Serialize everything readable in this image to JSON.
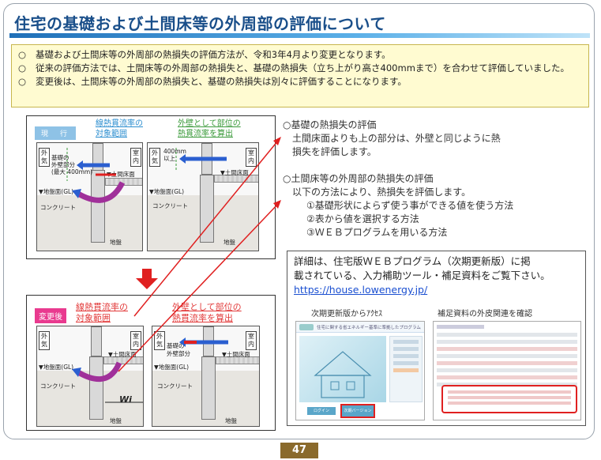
{
  "title": "住宅の基礎および土間床等の外周部の評価について",
  "notice": [
    {
      "bullet": "○",
      "text": "基礎および土間床等の外周部の熱損失の評価方法が、令和3年4月より変更となります。"
    },
    {
      "bullet": "○",
      "text": "従来の評価方法では、土間床等の外周部の熱損失と、基礎の熱損失（立ち上がり高さ400mmまで）を合わせて評価していました。"
    },
    {
      "bullet": "○",
      "text": "変更後は、土間床等の外周部の熱損失と、基礎の熱損失は別々に評価することになります。"
    }
  ],
  "current": {
    "tag": "現　行",
    "header_blue": [
      "線熱貫流率の",
      "対象範囲"
    ],
    "header_green": [
      "外壁として部位の",
      "熱貫流率を算出"
    ],
    "left": {
      "outside": [
        "外",
        "気"
      ],
      "inside": [
        "室",
        "内"
      ],
      "note": [
        "基礎の",
        "外壁部分",
        "(最大 400mm)"
      ],
      "floor": "▼土間床面",
      "gl": "▼地盤面(GL)",
      "concrete": "コンクリート",
      "ground": "地盤"
    },
    "right": {
      "outside": [
        "外",
        "気"
      ],
      "inside": [
        "室",
        "内"
      ],
      "note": [
        "400mm",
        "以上"
      ],
      "floor": "▼土間床面",
      "gl": "▼地盤面(GL)",
      "concrete": "コンクリート",
      "ground": "地盤"
    }
  },
  "after": {
    "tag": "変更後",
    "header_pink_left": [
      "線熱貫流率の",
      "対象範囲"
    ],
    "header_pink_right": [
      "外壁として部位の",
      "熱貫流率を算出"
    ],
    "left": {
      "outside": [
        "外",
        "気"
      ],
      "inside": [
        "室",
        "内"
      ],
      "floor": "▼土間床面",
      "gl": "▼地盤面(GL)",
      "concrete": "コンクリート",
      "wi": "Wi",
      "ground": "地盤"
    },
    "right": {
      "outside": [
        "外",
        "気"
      ],
      "inside": [
        "室",
        "内"
      ],
      "note": [
        "基礎の",
        "外壁部分"
      ],
      "floor": "▼土間床面",
      "gl": "▼地盤面(GL)",
      "concrete": "コンクリート",
      "ground": "地盤"
    }
  },
  "eval1": {
    "heading": "○基礎の熱損失の評価",
    "lines": [
      "土間床面よりも上の部分は、外壁と同じように熱",
      "損失を評価します。"
    ]
  },
  "eval2": {
    "heading": "○土間床等の外周部の熱損失の評価",
    "lines": [
      "以下の方法により、熱損失を評価します。",
      "①基礎形状によらず使う事ができる値を使う方法",
      "②表から値を選択する方法",
      "③ＷＥＢプログラムを用いる方法"
    ]
  },
  "detail": {
    "lines": [
      "詳細は、住宅版ＷＥＢプログラム（次期更新版）に掲",
      "載されている、入力補助ツール・補足資料をご覧下さい。"
    ],
    "link": "https://house.lowenergy.jp/",
    "caption_left": "次期更新版からｱｸｾｽ",
    "caption_right": "補足資料の外皮関連を確認",
    "thumb_left_title": "住宅に関する省エネルギー基準に準拠したプログラム",
    "thumb_left_btn1": "ログイン",
    "thumb_left_btn2": "次期バージョン"
  },
  "page_number": "47",
  "colors": {
    "title": "#1a4f8a",
    "notice_bg": "#fffbd1",
    "arrow_red": "#e02020",
    "heat_blue": "#2b5fd0",
    "heat_purple": "#a0309a",
    "page_badge": "#8a6a2c"
  }
}
